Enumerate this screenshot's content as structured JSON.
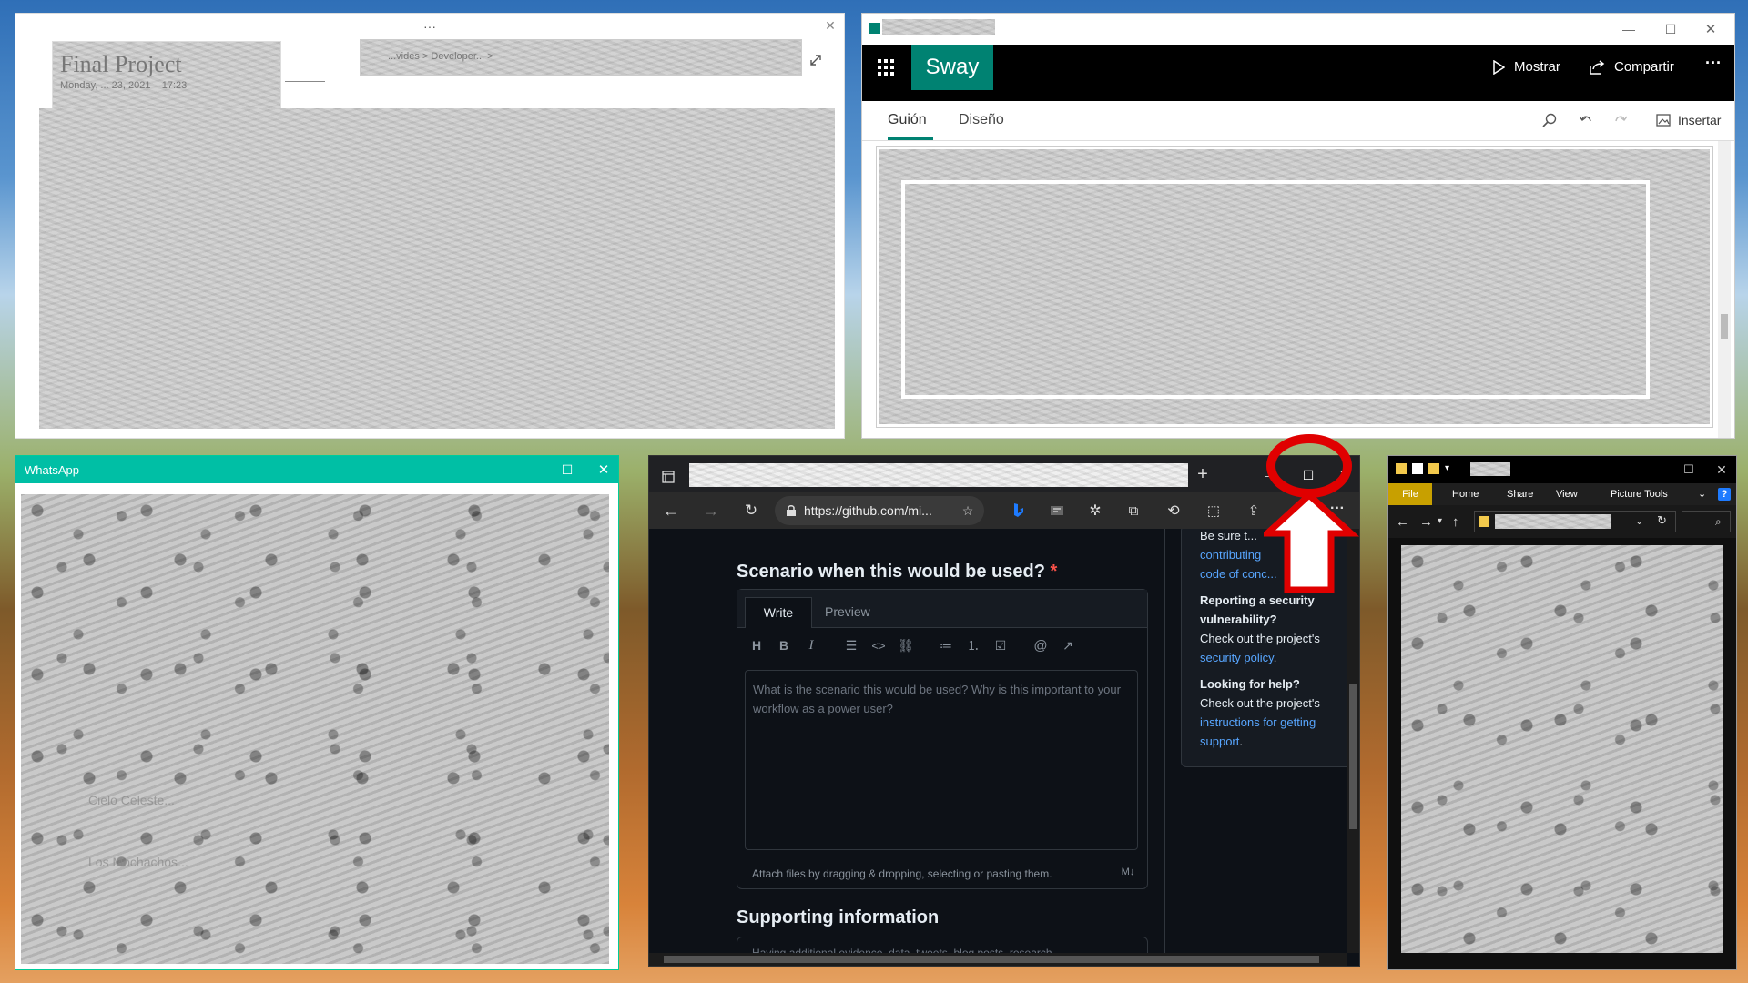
{
  "onenote": {
    "title": "Final Project",
    "date": "Monday, ... 23, 2021",
    "time": "17:23",
    "menu_dots": "···",
    "breadcrumb": "...vides >      Developer... >"
  },
  "sway": {
    "app_name": "Sway",
    "show_label": "Mostrar",
    "share_label": "Compartir",
    "more_label": "···",
    "tab_storyline": "Guión",
    "tab_design": "Diseño",
    "insert_label": "Insertar"
  },
  "whatsapp": {
    "title": "WhatsApp",
    "chat1": "Cielo Celeste...",
    "chat2": "Los Mochachos..."
  },
  "edge": {
    "url": "https://github.com/mi...",
    "scenario_heading": "Scenario when this would be used?",
    "required_mark": "*",
    "tab_write": "Write",
    "tab_preview": "Preview",
    "textarea_placeholder": "What is the scenario this would be used?  Why is this important to your workflow as a power user?",
    "attach_text": "Attach files by dragging & dropping, selecting or pasting them.",
    "supporting_heading": "Supporting information",
    "supporting_placeholder": "Having additional evidence, data, tweets, blog posts, research, ...",
    "sidebar": {
      "be_sure": "Be sure t...",
      "contributing": "contributing",
      "and": "and",
      "code_of_conduct": "code of conc...",
      "reporting_title": "Reporting a security vulnerability?",
      "check_out_1": "Check out the project's",
      "security_policy": "security policy",
      "period1": ".",
      "looking_title": "Looking for help?",
      "check_out_2": "Check out the project's",
      "instructions": "instructions for getting support",
      "period2": "."
    },
    "toolbar_tooltip_H": "H",
    "toolbar_tooltip_B": "B",
    "toolbar_tooltip_I": "I"
  },
  "explorer": {
    "tab_file": "File",
    "tab_home": "Home",
    "tab_share": "Share",
    "tab_view": "View",
    "tab_picture_tools": "Picture Tools",
    "help": "?"
  },
  "colors": {
    "whatsapp_green": "#00bfa5",
    "sway_green": "#008272",
    "github_link": "#58a6ff",
    "github_bg": "#0d1117",
    "annotation_red": "#e00000",
    "explorer_file_tab": "#c8a000"
  }
}
